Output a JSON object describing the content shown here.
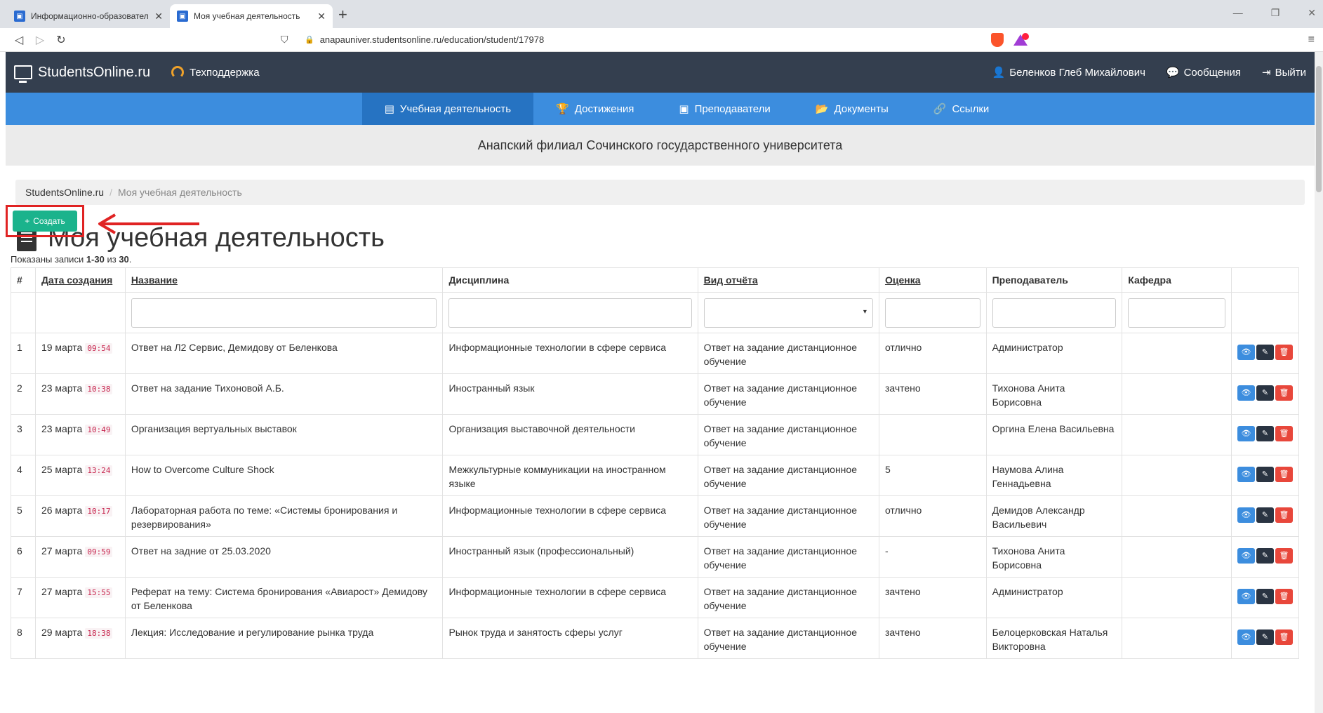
{
  "browser": {
    "tabs": [
      {
        "label": "Информационно-образовательн"
      },
      {
        "label": "Моя учебная деятельность"
      }
    ],
    "url": "anapauniver.studentsonline.ru/education/student/17978"
  },
  "header": {
    "brand": "StudentsOnline.ru",
    "support": "Техподдержка",
    "user": "Беленков Глеб Михайлович",
    "messages": "Сообщения",
    "logout": "Выйти"
  },
  "mainnav": [
    {
      "label": "Учебная деятельность",
      "icon": "document-icon"
    },
    {
      "label": "Достижения",
      "icon": "trophy-icon"
    },
    {
      "label": "Преподаватели",
      "icon": "contact-card-icon"
    },
    {
      "label": "Документы",
      "icon": "folder-icon"
    },
    {
      "label": "Ссылки",
      "icon": "link-icon"
    }
  ],
  "org_name": "Анапский филиал Сочинского государственного университета",
  "breadcrumb": {
    "home": "StudentsOnline.ru",
    "current": "Моя учебная деятельность"
  },
  "page_title": "Моя учебная деятельность",
  "create_label": "Создать",
  "summary": {
    "prefix": "Показаны записи ",
    "range": "1-30",
    "mid": " из ",
    "total": "30",
    "end": "."
  },
  "table": {
    "columns": [
      "#",
      "Дата создания",
      "Название",
      "Дисциплина",
      "Вид отчёта",
      "Оценка",
      "Преподаватель",
      "Кафедра"
    ],
    "rows": [
      {
        "n": "1",
        "date": "19 марта",
        "time": "09:54",
        "title": "Ответ на Л2 Сервис, Демидову от Беленкова",
        "discipline": "Информационные технологии в сфере сервиса",
        "report": "Ответ на задание дистанционное обучение",
        "grade": "отлично",
        "teacher": "Администратор",
        "dept": ""
      },
      {
        "n": "2",
        "date": "23 марта",
        "time": "10:38",
        "title": "Ответ на задание Тихоновой А.Б.",
        "discipline": "Иностранный язык",
        "report": "Ответ на задание дистанционное обучение",
        "grade": "зачтено",
        "teacher": "Тихонова Анита Борисовна",
        "dept": ""
      },
      {
        "n": "3",
        "date": "23 марта",
        "time": "10:49",
        "title": "Организация вертуальных выставок",
        "discipline": "Организация выставочной деятельности",
        "report": "Ответ на задание дистанционное обучение",
        "grade": "",
        "teacher": "Оргина Елена Васильевна",
        "dept": ""
      },
      {
        "n": "4",
        "date": "25 марта",
        "time": "13:24",
        "title": "How to Overcome Culture Shock",
        "discipline": "Межкультурные коммуникации на иностранном языке",
        "report": "Ответ на задание дистанционное обучение",
        "grade": "5",
        "teacher": "Наумова Алина Геннадьевна",
        "dept": ""
      },
      {
        "n": "5",
        "date": "26 марта",
        "time": "10:17",
        "title": "Лабораторная работа по теме: «Системы бронирования и резервирования»",
        "discipline": "Информационные технологии в сфере сервиса",
        "report": "Ответ на задание дистанционное обучение",
        "grade": "отлично",
        "teacher": "Демидов Александр Васильевич",
        "dept": ""
      },
      {
        "n": "6",
        "date": "27 марта",
        "time": "09:59",
        "title": "Ответ на задние от 25.03.2020",
        "discipline": "Иностранный язык (профессиональный)",
        "report": "Ответ на задание дистанционное обучение",
        "grade": "-",
        "teacher": "Тихонова Анита Борисовна",
        "dept": ""
      },
      {
        "n": "7",
        "date": "27 марта",
        "time": "15:55",
        "title": "Реферат на тему: Система бронирования «Авиарост» Демидову от Беленкова",
        "discipline": "Информационные технологии в сфере сервиса",
        "report": "Ответ на задание дистанционное обучение",
        "grade": "зачтено",
        "teacher": "Администратор",
        "dept": ""
      },
      {
        "n": "8",
        "date": "29 марта",
        "time": "18:38",
        "title": "Лекция: Исследование и регулирование рынка труда",
        "discipline": "Рынок труда и занятость сферы услуг",
        "report": "Ответ на задание дистанционное обучение",
        "grade": "зачтено",
        "teacher": "Белоцерковская Наталья Викторовна",
        "dept": ""
      }
    ]
  },
  "colors": {
    "topnav": "#343f4f",
    "mainnav": "#3c8dde",
    "create": "#1bb38c",
    "highlight": "#e02323"
  }
}
